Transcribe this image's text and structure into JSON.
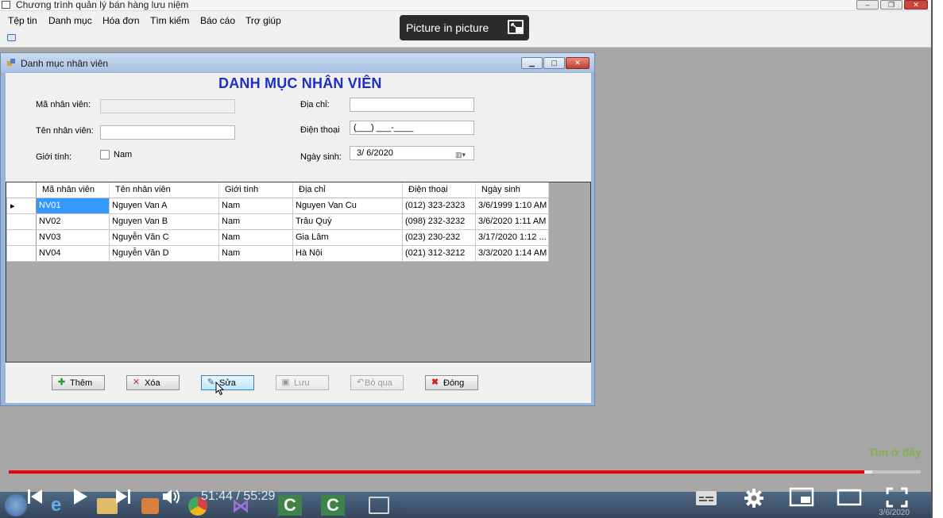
{
  "app": {
    "title": "Chương trình quản lý bán hàng lưu niệm",
    "menu": [
      "Tệp tin",
      "Danh mục",
      "Hóa đơn",
      "Tìm kiếm",
      "Báo cáo",
      "Trợ giúp"
    ]
  },
  "pip": {
    "label": "Picture in picture"
  },
  "window": {
    "title": "Danh mục nhân viên",
    "heading": "DANH MỤC NHÂN VIÊN"
  },
  "form": {
    "ma_nv_label": "Mã nhân viên:",
    "ma_nv_value": "",
    "ten_nv_label": "Tên nhân viên:",
    "ten_nv_value": "",
    "gioi_tinh_label": "Giới tính:",
    "nam_label": "Nam",
    "dia_chi_label": "Địa chỉ:",
    "dia_chi_value": "",
    "dien_thoai_label": "Điện thoại",
    "dien_thoai_value": "(___) ___-____",
    "ngay_sinh_label": "Ngày sinh:",
    "ngay_sinh_value": "3/  6/2020"
  },
  "grid": {
    "columns": [
      "Mã nhân viên",
      "Tên nhân viên",
      "Giới tính",
      "Địa chỉ",
      "Điện thoại",
      "Ngày sinh"
    ],
    "rows": [
      [
        "NV01",
        "Nguyen Van A",
        "Nam",
        "Nguyen Van Cu",
        "(012) 323-2323",
        "3/6/1999 1:10 AM"
      ],
      [
        "NV02",
        "Nguyen Van B",
        "Nam",
        "Trâu Quỳ",
        "(098) 232-3232",
        "3/6/2020 1:11 AM"
      ],
      [
        "NV03",
        "Nguyễn Văn C",
        "Nam",
        "Gia Lâm",
        "(023) 230-232",
        "3/17/2020 1:12 ..."
      ],
      [
        "NV04",
        "Nguyễn  Văn D",
        "Nam",
        "Hà Nội",
        "(021) 312-3212",
        "3/3/2020 1:14 AM"
      ]
    ]
  },
  "buttons": {
    "them": "Thêm",
    "xoa": "Xóa",
    "sua": "Sửa",
    "luu": "Lưu",
    "bo_qua": "Bỏ qua",
    "dong": "Đóng"
  },
  "player": {
    "time": "51:44 / 55:29",
    "progress": 0.938,
    "buffered": 0.947,
    "watermark": "Tìm ở đây",
    "clock_date": "3/6/2020"
  },
  "colors": {
    "heading": "#1f2fc6",
    "selection": "#3399ff",
    "progress": "#ee0000"
  }
}
